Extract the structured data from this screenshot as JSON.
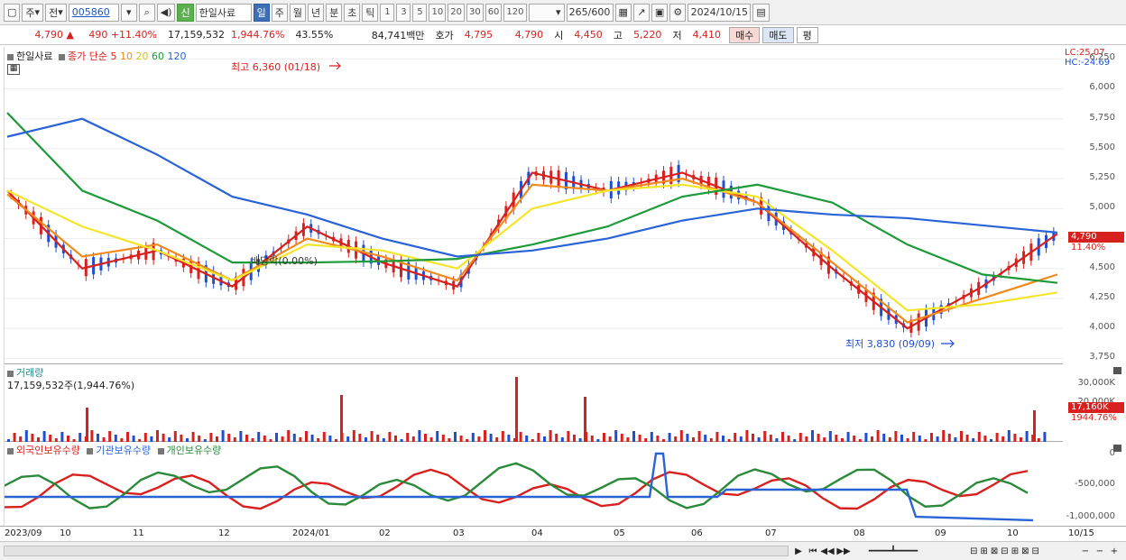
{
  "toolbar": {
    "mode_a": "주",
    "mode_b": "전",
    "code": "005860",
    "new_tag": "신",
    "name": "한일사료",
    "periods": [
      "일",
      "주",
      "월",
      "년",
      "분",
      "초",
      "틱"
    ],
    "nums": [
      "1",
      "3",
      "5",
      "10",
      "20",
      "30",
      "60",
      "120"
    ],
    "count": "265",
    "count_max": "/600",
    "date": "2024/10/15"
  },
  "quote": {
    "price": "4,790",
    "change": "490 +11.40%",
    "volume": "17,159,532",
    "vol_pct": "1,944.76%",
    "turnover": "43.55%",
    "amount": "84,741백만",
    "ask_label": "호가",
    "ask": "4,795",
    "bid": "4,790",
    "open_label": "시",
    "open": "4,450",
    "high_label": "고",
    "high": "5,220",
    "low_label": "저",
    "low": "4,410",
    "buy": "매수",
    "sell": "매도",
    "avg": "평"
  },
  "price_panel": {
    "legend_name": "한일사료",
    "legend_ma": "종가 단순",
    "ma5": "5",
    "ma10": "10",
    "ma20": "20",
    "ma60": "60",
    "ma120": "120",
    "lc": "LC:25.07",
    "hc": "HC:-24.69",
    "high_note": "최고 6,360 (01/18)",
    "low_note": "최저 3,830 (09/09)",
    "dividend": "배당락(0.00%)",
    "last_price": "4,790",
    "last_pct": "11.40%"
  },
  "volume_panel": {
    "title": "거래량",
    "value": "17,159,532주(1,944.76%)",
    "last": "17,160K",
    "last_pct": "1944.76%"
  },
  "holder_panel": {
    "foreign": "외국인보유수량",
    "inst": "기관보유수량",
    "indiv": "개인보유수량"
  },
  "x_labels": [
    "2023/09",
    "10",
    "11",
    "12",
    "2024/01",
    "02",
    "03",
    "04",
    "05",
    "06",
    "07",
    "08",
    "09",
    "10",
    "10/15"
  ],
  "y_price_labels": [
    "6,250",
    "6,000",
    "5,750",
    "5,500",
    "5,250",
    "5,000",
    "4,750",
    "4,500",
    "4,250",
    "4,000",
    "3,750"
  ],
  "y_volume_labels": [
    "30,000K",
    "20,000K"
  ],
  "y_holder_labels": [
    "0",
    "-500,000",
    "-1,000,000"
  ],
  "colors": {
    "up": "#d8211f",
    "down": "#1f4fd1",
    "ma5": "#d8211f",
    "ma10": "#f08a1c",
    "ma20": "#f2e52a",
    "ma60": "#1d9a3a",
    "ma120": "#2a63d6"
  },
  "chart_data": {
    "type": "line",
    "title": "",
    "xlabel": "",
    "ylabel": "",
    "ylim": [
      3700,
      6350
    ],
    "x": [
      "2023/09",
      "10",
      "11",
      "12",
      "2024/01",
      "02",
      "03",
      "04",
      "05",
      "06",
      "07",
      "08",
      "09",
      "10",
      "10/15"
    ],
    "series": [
      {
        "name": "5",
        "values": [
          5150,
          4500,
          4650,
          4350,
          4850,
          4550,
          4350,
          5300,
          5150,
          5300,
          5050,
          4500,
          4000,
          4350,
          4790
        ]
      },
      {
        "name": "10",
        "values": [
          5120,
          4600,
          4700,
          4400,
          4750,
          4600,
          4400,
          5200,
          5150,
          5250,
          5050,
          4550,
          4050,
          4250,
          4450
        ]
      },
      {
        "name": "20",
        "values": [
          5150,
          4850,
          4650,
          4400,
          4700,
          4650,
          4500,
          5000,
          5150,
          5200,
          5100,
          4650,
          4150,
          4200,
          4300
        ]
      },
      {
        "name": "60",
        "values": [
          5800,
          5150,
          4900,
          4550,
          4550,
          4560,
          4580,
          4700,
          4850,
          5100,
          5200,
          5050,
          4700,
          4450,
          4380
        ]
      },
      {
        "name": "120",
        "values": [
          5600,
          5750,
          5450,
          5100,
          4950,
          4750,
          4600,
          4650,
          4750,
          4900,
          5000,
          4950,
          4920,
          4860,
          4800
        ]
      }
    ]
  }
}
